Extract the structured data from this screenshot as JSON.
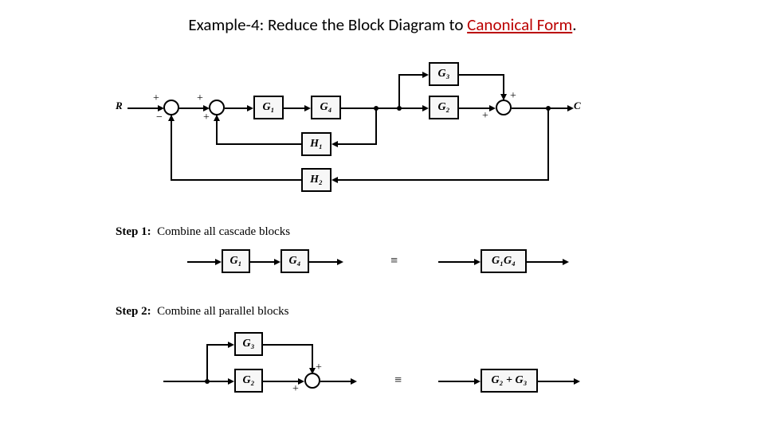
{
  "title": {
    "prefix": "Example-4: Reduce the Block Diagram to ",
    "highlight": "Canonical Form",
    "suffix": "."
  },
  "labels": {
    "R": "R",
    "C": "C",
    "G1": "G₁",
    "G2": "G₂",
    "G3": "G₃",
    "G4": "G₄",
    "H1": "H₁",
    "H2": "H₂",
    "G1G4": "G₁G₄",
    "G2pG3": "G₂ + G₃"
  },
  "signs": {
    "plus": "+",
    "minus": "−"
  },
  "steps": {
    "s1": {
      "heading": "Step 1:",
      "text": "Combine all cascade blocks"
    },
    "s2": {
      "heading": "Step 2:",
      "text": "Combine all parallel blocks"
    }
  },
  "equiv": "≡",
  "chart_data": {
    "type": "block-diagram",
    "title": "Reduce the Block Diagram to Canonical Form",
    "main": {
      "input": "R",
      "output": "C",
      "summing_junctions": [
        {
          "id": "S1",
          "inputs": [
            "R(+)",
            "H2_feedback(−)"
          ]
        },
        {
          "id": "S2",
          "inputs": [
            "S1(+)",
            "H1_feedback(+)"
          ]
        },
        {
          "id": "S3",
          "inputs": [
            "G2(+)",
            "G3(+)"
          ],
          "output": "C"
        }
      ],
      "forward_path": [
        "S1",
        "S2",
        "G1",
        "G4",
        "branch_A"
      ],
      "parallel_from_branch_A": {
        "paths": [
          "G3",
          "G2"
        ],
        "join": "S3"
      },
      "feedback_loops": [
        {
          "from": "branch_A",
          "through": "H1",
          "to": "S2",
          "sign": "+"
        },
        {
          "from": "C",
          "through": "H2",
          "to": "S1",
          "sign": "−"
        }
      ]
    },
    "step1": {
      "rule": "cascade",
      "lhs": [
        "G1",
        "G4"
      ],
      "rhs": "G1·G4"
    },
    "step2": {
      "rule": "parallel(+,+)",
      "lhs": [
        "G3",
        "G2"
      ],
      "rhs": "G2 + G3"
    }
  }
}
